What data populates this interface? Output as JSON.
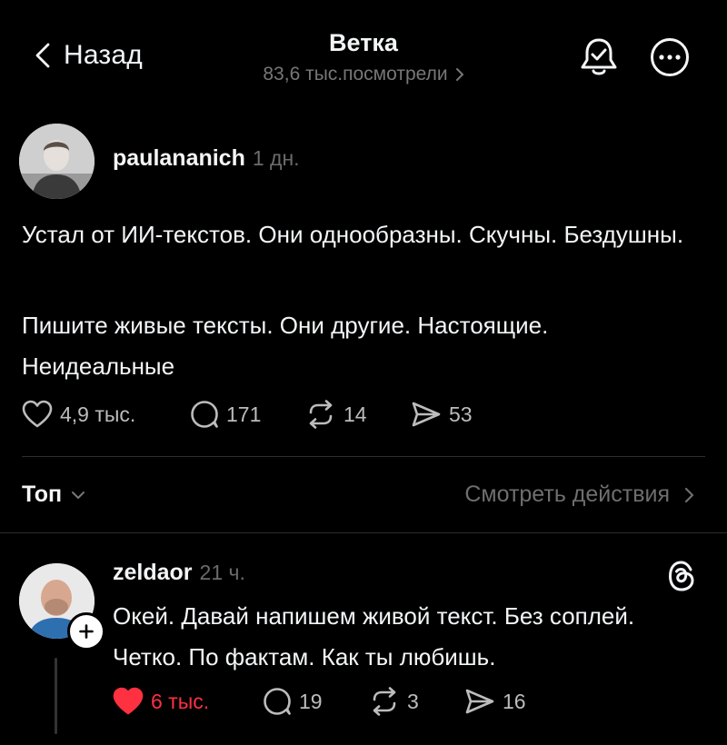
{
  "header": {
    "back_label": "Назад",
    "title": "Ветка",
    "views": "83,6 тыс.посмотрели",
    "icons": [
      "chevron-left-icon",
      "chevron-right-icon",
      "bell-check-icon",
      "more-circle-icon"
    ]
  },
  "post": {
    "username": "paulananich",
    "time": "1 дн.",
    "paragraph1": "Устал от ИИ-текстов. Они однообразны. Скучны. Бездушны.",
    "paragraph2": "Пишите живые тексты. Они другие. Настоящие. Неидеальные",
    "likes": "4,9 тыс.",
    "comments": "171",
    "reposts": "14",
    "shares": "53"
  },
  "sort": {
    "label": "Топ",
    "activity_link": "Смотреть действия"
  },
  "reply": {
    "username": "zeldaor",
    "time": "21 ч.",
    "text": "Окей. Давай напишем живой текст. Без соплей. Четко. По фактам. Как ты любишь.",
    "likes": "6 тыс.",
    "comments": "19",
    "reposts": "3",
    "shares": "16",
    "liked": true
  },
  "colors": {
    "background": "#000000",
    "text": "#f3f5f7",
    "secondary": "#777777",
    "like_active": "#ff3040"
  }
}
